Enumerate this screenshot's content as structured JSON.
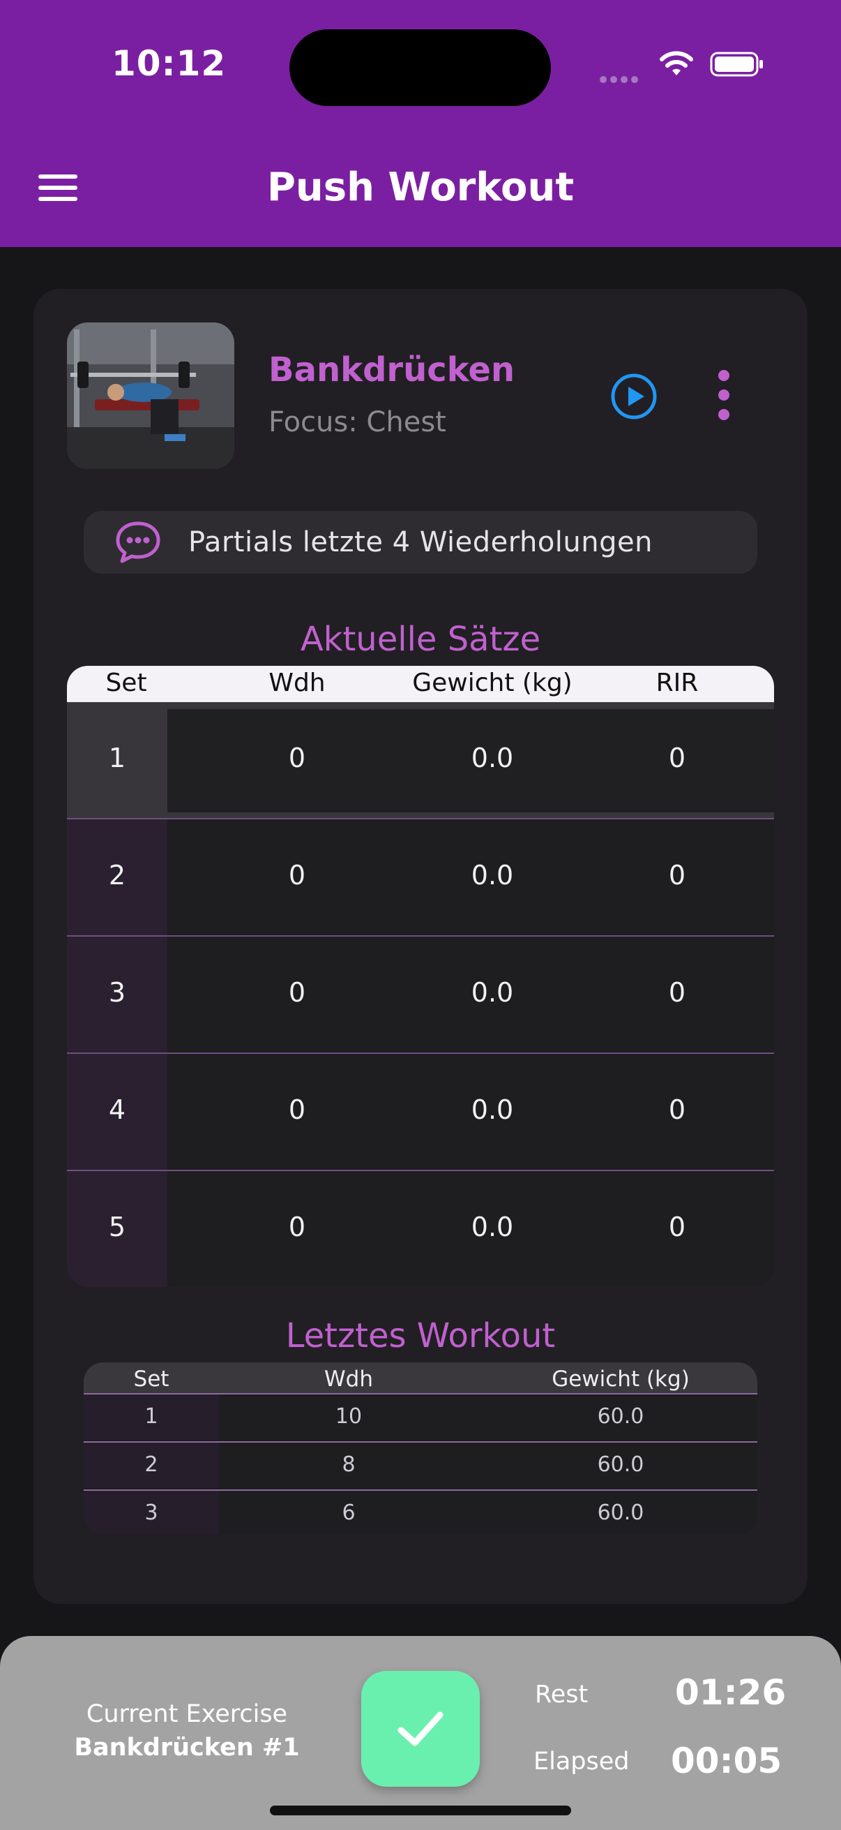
{
  "status_bar": {
    "time": "10:12"
  },
  "header": {
    "title": "Push Workout",
    "menu_icon": "hamburger-menu-icon"
  },
  "exercise": {
    "name": "Bankdrücken",
    "focus": "Focus: Chest",
    "thumbnail": "bench-press-photo",
    "play_icon": "play-circle-icon",
    "more_icon": "more-vertical-icon"
  },
  "note": {
    "icon": "chat-bubble-icon",
    "text": "Partials letzte 4 Wiederholungen"
  },
  "current_sets": {
    "title": "Aktuelle Sätze",
    "columns": [
      "Set",
      "Wdh",
      "Gewicht (kg)",
      "RIR"
    ],
    "rows": [
      {
        "set": "1",
        "reps": "0",
        "weight": "0.0",
        "rir": "0"
      },
      {
        "set": "2",
        "reps": "0",
        "weight": "0.0",
        "rir": "0"
      },
      {
        "set": "3",
        "reps": "0",
        "weight": "0.0",
        "rir": "0"
      },
      {
        "set": "4",
        "reps": "0",
        "weight": "0.0",
        "rir": "0"
      },
      {
        "set": "5",
        "reps": "0",
        "weight": "0.0",
        "rir": "0"
      }
    ]
  },
  "last_workout": {
    "title": "Letztes Workout",
    "columns": [
      "Set",
      "Wdh",
      "Gewicht (kg)"
    ],
    "rows": [
      {
        "set": "1",
        "reps": "10",
        "weight": "60.0"
      },
      {
        "set": "2",
        "reps": "8",
        "weight": "60.0"
      },
      {
        "set": "3",
        "reps": "6",
        "weight": "60.0"
      }
    ]
  },
  "bottom_bar": {
    "current_label": "Current Exercise",
    "current_name": "Bankdrücken #1",
    "rest_label": "Rest",
    "rest_value": "01:26",
    "elapsed_label": "Elapsed",
    "elapsed_value": "00:05",
    "done_icon": "checkmark-icon"
  },
  "colors": {
    "appbar": "#7b1fa2",
    "accent": "#c061cf",
    "done_button": "#69f0ae",
    "play_blue": "#2196f3"
  }
}
